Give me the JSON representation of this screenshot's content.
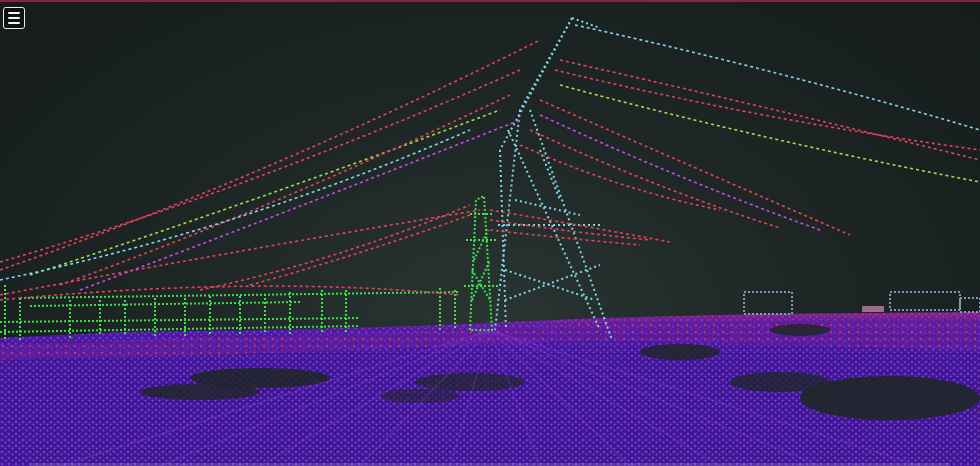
{
  "viewer": {
    "menu_icon": "hamburger-menu-icon",
    "background_color": "#1b2322",
    "accent_color": "#8a2240"
  },
  "point_classes": {
    "ground": "#6a1fd6",
    "ground_highlight": "#e0306a",
    "tower": "#7fd8e8",
    "conductor_red": "#e8405a",
    "conductor_green": "#9be04a",
    "conductor_magenta": "#c84ae8",
    "substation": "#3fe04a",
    "building": "#8ab8e8"
  }
}
